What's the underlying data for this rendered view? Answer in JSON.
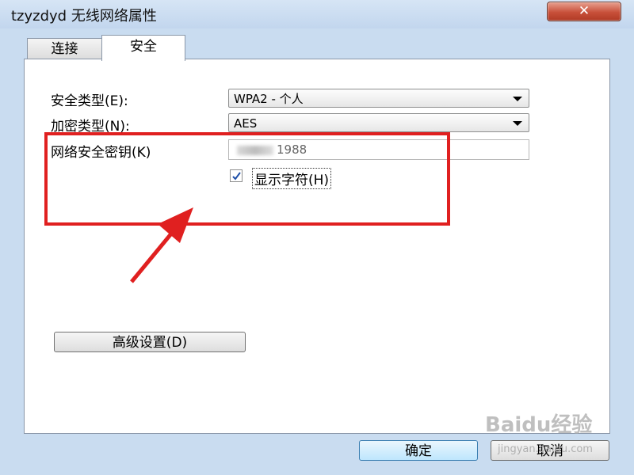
{
  "window": {
    "title": "tzyzdyd 无线网络属性",
    "close_icon": "close-icon",
    "close_glyph": "✕"
  },
  "tabs": [
    {
      "label": "连接",
      "active": false
    },
    {
      "label": "安全",
      "active": true
    }
  ],
  "security": {
    "type_label": "安全类型(E):",
    "type_value": "WPA2 - 个人",
    "encryption_label": "加密类型(N):",
    "encryption_value": "AES",
    "key_label": "网络安全密钥(K)",
    "key_value_visible": "1988",
    "show_chars_label": "显示字符(H)",
    "show_chars_checked": true
  },
  "buttons": {
    "advanced": "高级设置(D)",
    "ok": "确定",
    "cancel": "取消"
  },
  "annotation": {
    "color": "#e02020"
  },
  "watermark": {
    "text": "Baidu经验",
    "url": "jingyan.baidu.com"
  }
}
